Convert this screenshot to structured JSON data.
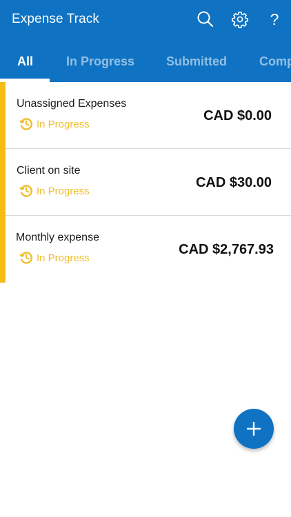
{
  "app": {
    "title": "Expense Track",
    "accent_color": "#0f72c2",
    "status_color": "#f0be2a"
  },
  "toolbar": {
    "search_icon": "search-icon",
    "settings_icon": "gear-icon",
    "help_label": "?"
  },
  "tabs": [
    {
      "label": "All",
      "active": true
    },
    {
      "label": "In Progress",
      "active": false
    },
    {
      "label": "Submitted",
      "active": false
    },
    {
      "label": "Comp",
      "active": false
    }
  ],
  "expenses": [
    {
      "name": "Unassigned Expenses",
      "status": "In Progress",
      "amount": "CAD $0.00"
    },
    {
      "name": "Client on site",
      "status": "In Progress",
      "amount": "CAD $30.00"
    },
    {
      "name": "Monthly expense",
      "status": "In Progress",
      "amount": "CAD $2,767.93"
    }
  ],
  "fab": {
    "icon": "plus-icon"
  }
}
